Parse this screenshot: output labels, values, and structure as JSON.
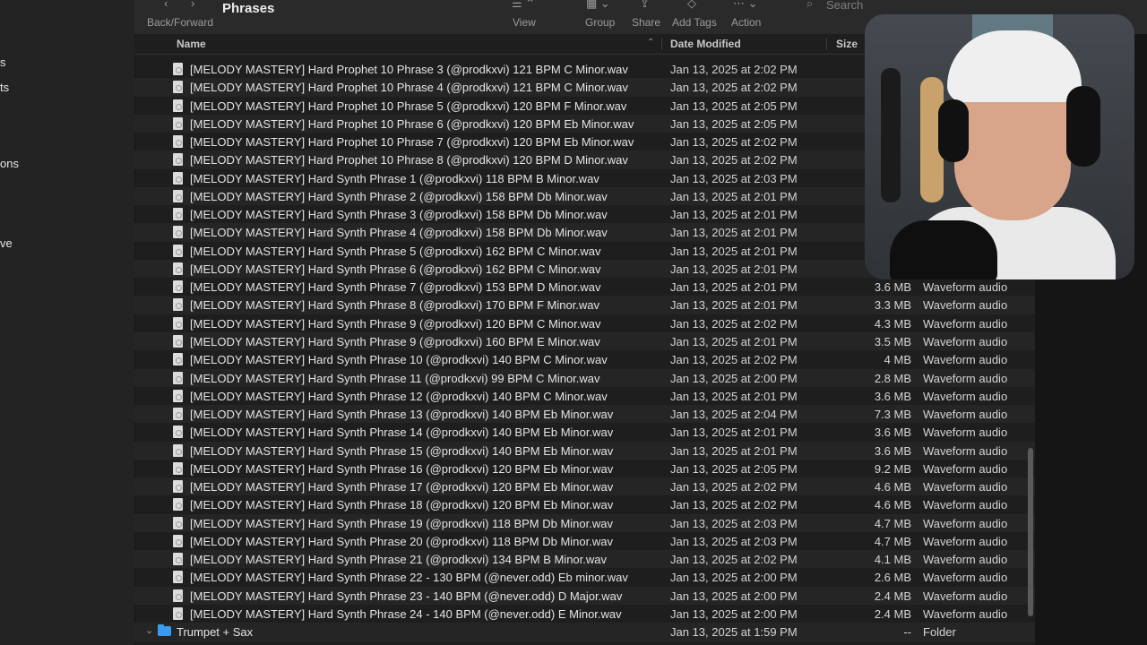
{
  "sidebar": {
    "items": [
      "s",
      "ts",
      "ons",
      "ve"
    ]
  },
  "toolbar": {
    "back_forward_label": "Back/Forward",
    "title": "Phrases",
    "view_label": "View",
    "group_label": "Group",
    "share_label": "Share",
    "add_tags_label": "Add Tags",
    "action_label": "Action",
    "search_placeholder": "Search"
  },
  "columns": {
    "name": "Name",
    "date_modified": "Date Modified",
    "size": "Size"
  },
  "files": [
    {
      "name": "[MELODY MASTERY]  Hard Prophet 10 Phrase 3 (@prodkxvi) 121 BPM C Minor.wav",
      "date": "Jan 13, 2025 at 2:02 PM",
      "size": "",
      "kind": ""
    },
    {
      "name": "[MELODY MASTERY]  Hard Prophet 10 Phrase 4 (@prodkxvi) 121 BPM C Minor.wav",
      "date": "Jan 13, 2025 at 2:02 PM",
      "size": "",
      "kind": ""
    },
    {
      "name": "[MELODY MASTERY]  Hard Prophet 10 Phrase 5 (@prodkxvi) 120 BPM F Minor.wav",
      "date": "Jan 13, 2025 at 2:05 PM",
      "size": "",
      "kind": ""
    },
    {
      "name": "[MELODY MASTERY]  Hard Prophet 10 Phrase 6 (@prodkxvi) 120 BPM Eb Minor.wav",
      "date": "Jan 13, 2025 at 2:05 PM",
      "size": "",
      "kind": ""
    },
    {
      "name": "[MELODY MASTERY]  Hard Prophet 10 Phrase 7 (@prodkxvi) 120 BPM Eb Minor.wav",
      "date": "Jan 13, 2025 at 2:02 PM",
      "size": "",
      "kind": ""
    },
    {
      "name": "[MELODY MASTERY]  Hard Prophet 10 Phrase 8 (@prodkxvi) 120 BPM D Minor.wav",
      "date": "Jan 13, 2025 at 2:02 PM",
      "size": "",
      "kind": ""
    },
    {
      "name": "[MELODY MASTERY]  Hard Synth Phrase 1 (@prodkxvi) 118 BPM B Minor.wav",
      "date": "Jan 13, 2025 at 2:03 PM",
      "size": "",
      "kind": ""
    },
    {
      "name": "[MELODY MASTERY]  Hard Synth Phrase 2 (@prodkxvi) 158 BPM Db Minor.wav",
      "date": "Jan 13, 2025 at 2:01 PM",
      "size": "",
      "kind": ""
    },
    {
      "name": "[MELODY MASTERY]  Hard Synth Phrase 3 (@prodkxvi) 158 BPM Db Minor.wav",
      "date": "Jan 13, 2025 at 2:01 PM",
      "size": "",
      "kind": ""
    },
    {
      "name": "[MELODY MASTERY]  Hard Synth Phrase 4 (@prodkxvi) 158 BPM Db Minor.wav",
      "date": "Jan 13, 2025 at 2:01 PM",
      "size": "",
      "kind": ""
    },
    {
      "name": "[MELODY MASTERY]  Hard Synth Phrase 5 (@prodkxvi) 162 BPM C Minor.wav",
      "date": "Jan 13, 2025 at 2:01 PM",
      "size": "",
      "kind": ""
    },
    {
      "name": "[MELODY MASTERY]  Hard Synth Phrase 6 (@prodkxvi) 162 BPM C Minor.wav",
      "date": "Jan 13, 2025 at 2:01 PM",
      "size": "",
      "kind": ""
    },
    {
      "name": "[MELODY MASTERY]  Hard Synth Phrase 7 (@prodkxvi) 153 BPM D Minor.wav",
      "date": "Jan 13, 2025 at 2:01 PM",
      "size": "3.6 MB",
      "kind": "Waveform audio"
    },
    {
      "name": "[MELODY MASTERY]  Hard Synth Phrase 8 (@prodkxvi) 170 BPM F Minor.wav",
      "date": "Jan 13, 2025 at 2:01 PM",
      "size": "3.3 MB",
      "kind": "Waveform audio"
    },
    {
      "name": "[MELODY MASTERY]  Hard Synth Phrase 9 (@prodkxvi) 120 BPM C Minor.wav",
      "date": "Jan 13, 2025 at 2:02 PM",
      "size": "4.3 MB",
      "kind": "Waveform audio"
    },
    {
      "name": "[MELODY MASTERY]  Hard Synth Phrase 9 (@prodkxvi) 160 BPM E Minor.wav",
      "date": "Jan 13, 2025 at 2:01 PM",
      "size": "3.5 MB",
      "kind": "Waveform audio"
    },
    {
      "name": "[MELODY MASTERY]  Hard Synth Phrase 10 (@prodkxvi) 140 BPM C Minor.wav",
      "date": "Jan 13, 2025 at 2:02 PM",
      "size": "4 MB",
      "kind": "Waveform audio"
    },
    {
      "name": "[MELODY MASTERY]  Hard Synth Phrase 11 (@prodkxvi) 99 BPM C Minor.wav",
      "date": "Jan 13, 2025 at 2:00 PM",
      "size": "2.8 MB",
      "kind": "Waveform audio"
    },
    {
      "name": "[MELODY MASTERY]  Hard Synth Phrase 12 (@prodkxvi) 140 BPM C Minor.wav",
      "date": "Jan 13, 2025 at 2:01 PM",
      "size": "3.6 MB",
      "kind": "Waveform audio"
    },
    {
      "name": "[MELODY MASTERY]  Hard Synth Phrase 13 (@prodkxvi) 140 BPM Eb Minor.wav",
      "date": "Jan 13, 2025 at 2:04 PM",
      "size": "7.3 MB",
      "kind": "Waveform audio"
    },
    {
      "name": "[MELODY MASTERY]  Hard Synth Phrase 14 (@prodkxvi) 140 BPM Eb Minor.wav",
      "date": "Jan 13, 2025 at 2:01 PM",
      "size": "3.6 MB",
      "kind": "Waveform audio"
    },
    {
      "name": "[MELODY MASTERY]  Hard Synth Phrase 15 (@prodkxvi) 140 BPM Eb Minor.wav",
      "date": "Jan 13, 2025 at 2:01 PM",
      "size": "3.6 MB",
      "kind": "Waveform audio"
    },
    {
      "name": "[MELODY MASTERY]  Hard Synth Phrase 16 (@prodkxvi) 120 BPM Eb Minor.wav",
      "date": "Jan 13, 2025 at 2:05 PM",
      "size": "9.2 MB",
      "kind": "Waveform audio"
    },
    {
      "name": "[MELODY MASTERY]  Hard Synth Phrase 17 (@prodkxvi) 120 BPM Eb Minor.wav",
      "date": "Jan 13, 2025 at 2:02 PM",
      "size": "4.6 MB",
      "kind": "Waveform audio"
    },
    {
      "name": "[MELODY MASTERY]  Hard Synth Phrase 18 (@prodkxvi) 120 BPM Eb Minor.wav",
      "date": "Jan 13, 2025 at 2:02 PM",
      "size": "4.6 MB",
      "kind": "Waveform audio"
    },
    {
      "name": "[MELODY MASTERY]  Hard Synth Phrase 19 (@prodkxvi) 118 BPM Db Minor.wav",
      "date": "Jan 13, 2025 at 2:03 PM",
      "size": "4.7 MB",
      "kind": "Waveform audio"
    },
    {
      "name": "[MELODY MASTERY]  Hard Synth Phrase 20 (@prodkxvi) 118 BPM Db Minor.wav",
      "date": "Jan 13, 2025 at 2:03 PM",
      "size": "4.7 MB",
      "kind": "Waveform audio"
    },
    {
      "name": "[MELODY MASTERY]  Hard Synth Phrase 21 (@prodkxvi) 134 BPM B Minor.wav",
      "date": "Jan 13, 2025 at 2:02 PM",
      "size": "4.1 MB",
      "kind": "Waveform audio"
    },
    {
      "name": "[MELODY MASTERY]  Hard Synth Phrase 22 - 130 BPM (@never.odd) Eb minor.wav",
      "date": "Jan 13, 2025 at 2:00 PM",
      "size": "2.6 MB",
      "kind": "Waveform audio"
    },
    {
      "name": "[MELODY MASTERY]  Hard Synth Phrase 23 - 140 BPM (@never.odd) D Major.wav",
      "date": "Jan 13, 2025 at 2:00 PM",
      "size": "2.4 MB",
      "kind": "Waveform audio"
    },
    {
      "name": "[MELODY MASTERY]  Hard Synth Phrase 24 - 140 BPM (@never.odd) E Minor.wav",
      "date": "Jan 13, 2025 at 2:00 PM",
      "size": "2.4 MB",
      "kind": "Waveform audio"
    }
  ],
  "folder": {
    "name": "Trumpet + Sax",
    "date": "Jan 13, 2025 at 1:59 PM",
    "size": "--",
    "kind": "Folder"
  },
  "icons": {
    "back": "chevron-left-icon",
    "view": "list-view-icon",
    "group": "group-icon",
    "share": "share-icon",
    "tag": "tag-icon",
    "action": "ellipsis-icon",
    "search": "search-icon",
    "file": "audio-file-icon",
    "folder": "folder-icon"
  },
  "colors": {
    "folder": "#3a9bf0",
    "background": "#1e1e1e"
  }
}
